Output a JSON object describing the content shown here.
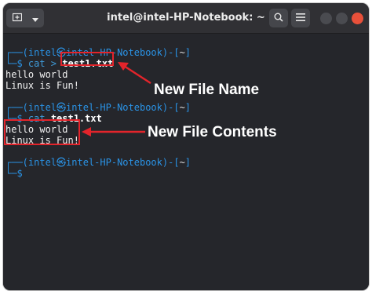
{
  "window": {
    "title": "intel@intel-HP-Notebook: ~"
  },
  "terminal": {
    "prompt_user": "intel",
    "prompt_host": "intel-HP-Notebook",
    "prompt_dir": "~",
    "blocks": [
      {
        "command_prefix": "cat > ",
        "command_arg": "test1.txt",
        "output": [
          "hello world",
          "Linux is Fun!"
        ]
      },
      {
        "command_prefix": "cat ",
        "command_arg": "test1.txt",
        "output": [
          "hello world",
          "Linux is Fun!"
        ]
      },
      {
        "command_prefix": "",
        "command_arg": "",
        "output": []
      }
    ]
  },
  "annotations": {
    "file_name_label": "New File Name",
    "file_contents_label": "New File Contents",
    "color": "#e3242b"
  },
  "icons": {
    "new_tab": "new-tab-icon",
    "dropdown": "chevron-down-icon",
    "search": "search-icon",
    "menu": "hamburger-menu-icon"
  }
}
